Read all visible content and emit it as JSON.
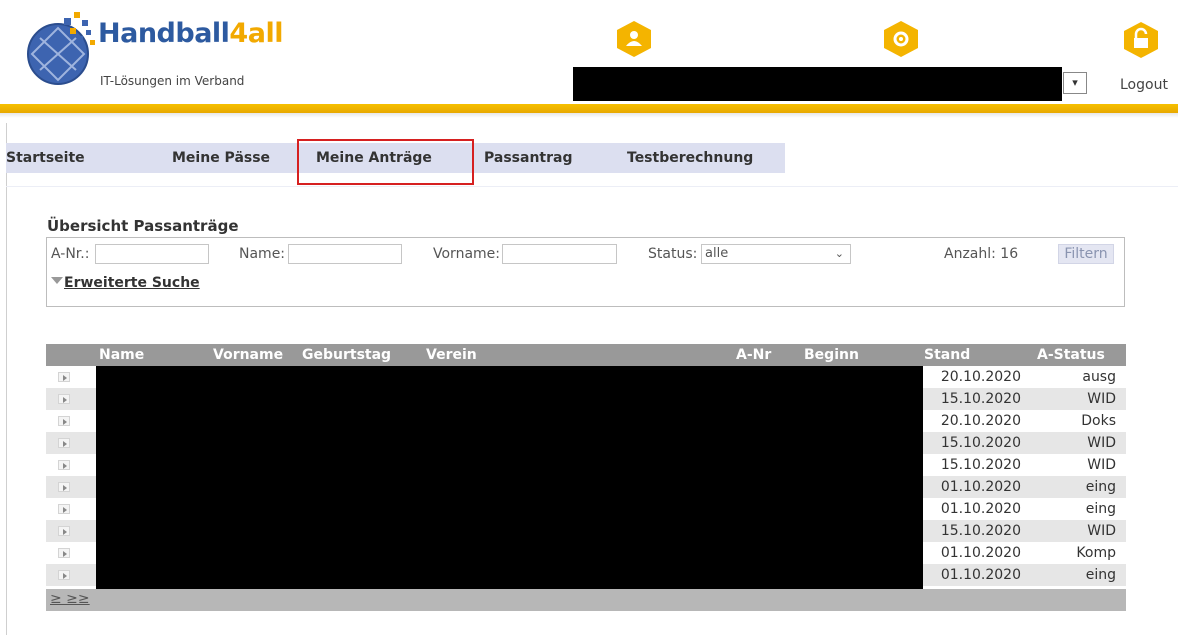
{
  "logo": {
    "brand_main": "Handball",
    "brand_four": "4",
    "brand_all": "all",
    "tagline": "IT-Lösungen im Verband"
  },
  "header": {
    "logout_label": "Logout",
    "select_value": "▾"
  },
  "nav": {
    "items": [
      {
        "label": "Startseite"
      },
      {
        "label": "Meine Pässe"
      },
      {
        "label": "Meine Anträge"
      },
      {
        "label": "Passantrag"
      },
      {
        "label": "Testberechnung"
      }
    ]
  },
  "search": {
    "title": "Übersicht Passanträge",
    "anr_label": "A-Nr.:",
    "name_label": "Name:",
    "vorname_label": "Vorname:",
    "status_label": "Status:",
    "status_value": "alle",
    "count_label": "Anzahl: 16",
    "filter_label": "Filtern",
    "extended_label": "Erweiterte Suche"
  },
  "table": {
    "headers": [
      "Name",
      "Vorname",
      "Geburtstag",
      "Verein",
      "A-Nr",
      "Beginn",
      "Stand",
      "A-Status"
    ],
    "rows": [
      {
        "stand": "20.10.2020",
        "status": "ausg"
      },
      {
        "stand": "15.10.2020",
        "status": "WID"
      },
      {
        "stand": "20.10.2020",
        "status": "Doks"
      },
      {
        "stand": "15.10.2020",
        "status": "WID"
      },
      {
        "stand": "15.10.2020",
        "status": "WID"
      },
      {
        "stand": "01.10.2020",
        "status": "eing"
      },
      {
        "stand": "01.10.2020",
        "status": "eing"
      },
      {
        "stand": "15.10.2020",
        "status": "WID"
      },
      {
        "stand": "01.10.2020",
        "status": "Komp"
      },
      {
        "stand": "01.10.2020",
        "status": "eing"
      }
    ],
    "pager": "≥  ≥≥"
  },
  "colors": {
    "accent": "#f2a900",
    "brand": "#2d5aa0",
    "nav_bg": "#dcdff0",
    "highlight": "#d62020",
    "row_odd": "#ffffff",
    "row_even": "#e6e6e6"
  }
}
